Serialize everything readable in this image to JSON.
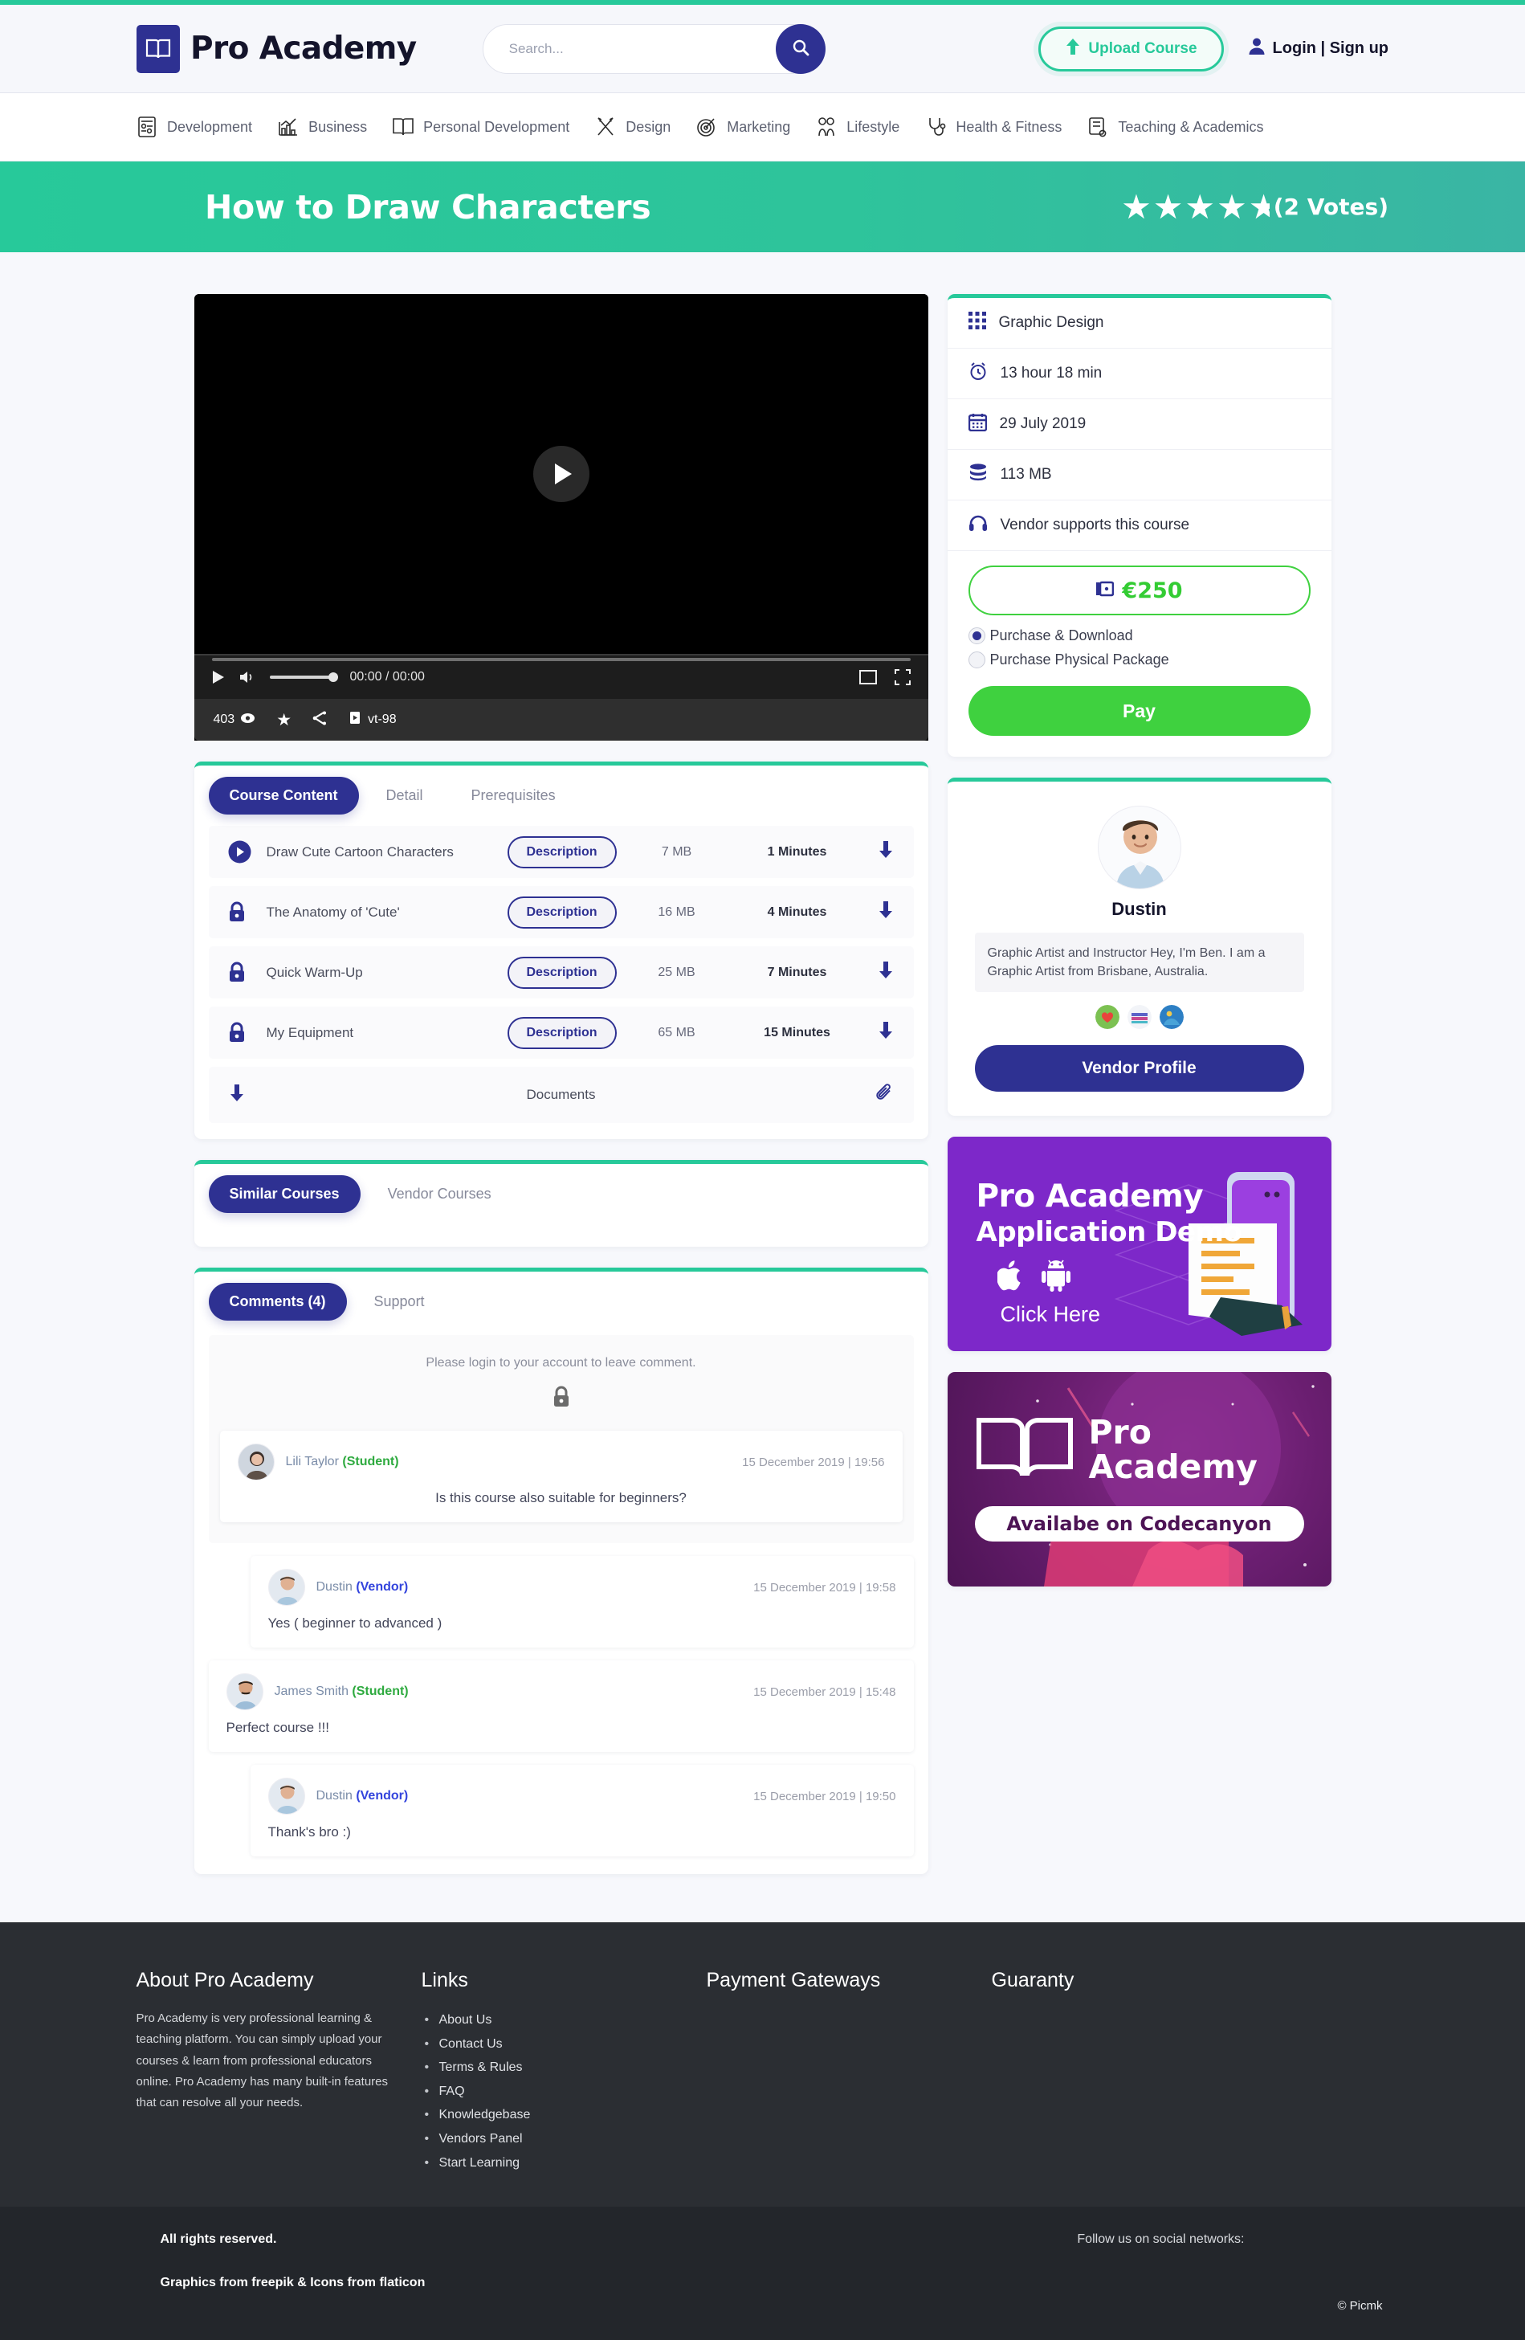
{
  "brand": {
    "name": "Pro Academy",
    "logo_icon": "open-book-icon"
  },
  "search": {
    "placeholder": "Search...",
    "value": "",
    "icon": "search-icon"
  },
  "header": {
    "upload_label": "Upload Course",
    "upload_icon": "upload-arrow-icon",
    "account_label": "Login | Sign up",
    "account_icon": "user-icon"
  },
  "categories": [
    {
      "label": "Development",
      "icon": "development-icon"
    },
    {
      "label": "Business",
      "icon": "chart-icon"
    },
    {
      "label": "Personal Development",
      "icon": "book-icon"
    },
    {
      "label": "Design",
      "icon": "pencil-ruler-icon"
    },
    {
      "label": "Marketing",
      "icon": "target-icon"
    },
    {
      "label": "Lifestyle",
      "icon": "lifestyle-icon"
    },
    {
      "label": "Health & Fitness",
      "icon": "stethoscope-icon"
    },
    {
      "label": "Teaching & Academics",
      "icon": "teaching-icon"
    }
  ],
  "hero": {
    "title": "How to Draw Characters",
    "rating_value": 4.5,
    "stars_total": 5,
    "votes_label": "(2 Votes)"
  },
  "video": {
    "time_display": "00:00 / 00:00",
    "volume_percent": 100,
    "progress_percent": 0,
    "play_icon": "play-icon",
    "volume_icon": "volume-icon",
    "pip_icon": "picture-in-picture-icon",
    "fullscreen_icon": "fullscreen-icon",
    "stats": {
      "views": "403",
      "views_icon": "eye-icon",
      "favorite_icon": "star-icon",
      "share_icon": "share-icon",
      "playlist_icon": "playlist-icon",
      "video_code": "vt-98"
    }
  },
  "content_tabs": {
    "tabs": [
      {
        "label": "Course Content",
        "active": true
      },
      {
        "label": "Detail",
        "active": false
      },
      {
        "label": "Prerequisites",
        "active": false
      }
    ],
    "rows": [
      {
        "icon": "play-circle-icon",
        "title": "Draw Cute Cartoon Characters",
        "button": "Description",
        "size": "7 MB",
        "duration": "1 Minutes",
        "download_icon": "download-icon"
      },
      {
        "icon": "lock-icon",
        "title": "The Anatomy of 'Cute'",
        "button": "Description",
        "size": "16 MB",
        "duration": "4 Minutes",
        "download_icon": "download-icon"
      },
      {
        "icon": "lock-icon",
        "title": "Quick Warm-Up",
        "button": "Description",
        "size": "25 MB",
        "duration": "7 Minutes",
        "download_icon": "download-icon"
      },
      {
        "icon": "lock-icon",
        "title": "My Equipment",
        "button": "Description",
        "size": "65 MB",
        "duration": "15 Minutes",
        "download_icon": "download-icon"
      }
    ],
    "documents_row": {
      "label": "Documents",
      "download_icon": "download-icon",
      "attach_icon": "paperclip-icon"
    }
  },
  "similar_tabs": {
    "tabs": [
      {
        "label": "Similar Courses",
        "active": true
      },
      {
        "label": "Vendor Courses",
        "active": false
      }
    ]
  },
  "comments_tabs": {
    "tabs": [
      {
        "label": "Comments (4)",
        "active": true
      },
      {
        "label": "Support",
        "active": false
      }
    ],
    "login_notice": "Please login to your account to leave comment.",
    "login_notice_icon": "lock-icon",
    "items": [
      {
        "user": "Lili Taylor",
        "role": "(Student)",
        "role_type": "student",
        "date": "15 December 2019 | 19:56",
        "text": "Is this course also suitable for beginners?",
        "indent": false,
        "avatar": "female-avatar"
      },
      {
        "user": "Dustin",
        "role": "(Vendor)",
        "role_type": "vendor",
        "date": "15 December 2019 | 19:58",
        "text": "Yes ( beginner to advanced )",
        "indent": true,
        "avatar": "male-avatar"
      },
      {
        "user": "James Smith",
        "role": "(Student)",
        "role_type": "student",
        "date": "15 December 2019 | 15:48",
        "text": "Perfect course !!!",
        "indent": false,
        "avatar": "male-avatar-2"
      },
      {
        "user": "Dustin",
        "role": "(Vendor)",
        "role_type": "vendor",
        "date": "15 December 2019 | 19:50",
        "text": "Thank's bro :)",
        "indent": true,
        "avatar": "male-avatar"
      }
    ]
  },
  "course_meta": [
    {
      "icon": "grid-icon",
      "label": "Graphic Design"
    },
    {
      "icon": "alarm-clock-icon",
      "label": "13 hour 18 min"
    },
    {
      "icon": "calendar-icon",
      "label": "29 July 2019"
    },
    {
      "icon": "database-icon",
      "label": "113 MB"
    },
    {
      "icon": "headset-icon",
      "label": "Vendor supports this course"
    }
  ],
  "purchase": {
    "price": "€250",
    "price_icon": "wallet-icon",
    "options": [
      {
        "label": "Purchase & Download",
        "selected": true
      },
      {
        "label": "Purchase Physical Package",
        "selected": false
      }
    ],
    "pay_label": "Pay"
  },
  "vendor": {
    "name": "Dustin",
    "bio": "Graphic Artist and Instructor Hey, I'm Ben. I am a Graphic Artist from Brisbane, Australia.",
    "social_icons": [
      "heart-badge-icon",
      "book-badge-icon",
      "globe-badge-icon"
    ],
    "profile_button": "Vendor Profile"
  },
  "banners": [
    {
      "id": "app-demo",
      "line1": "Pro Academy",
      "line2": "Application Demo",
      "cta": "Click Here",
      "store_icons": [
        "apple-icon",
        "android-icon"
      ]
    },
    {
      "id": "codecanyon",
      "line1": "Pro",
      "line2": "Academy",
      "cta": "Availabe on Codecanyon",
      "logo_icon": "open-book-icon"
    }
  ],
  "footer": {
    "about": {
      "heading": "About Pro Academy",
      "text": "Pro Academy is very professional learning & teaching platform. You can simply upload your courses & learn from professional educators online. Pro Academy has many built-in features that can resolve all your needs."
    },
    "links": {
      "heading": "Links",
      "items": [
        "About Us",
        "Contact Us",
        "Terms & Rules",
        "FAQ",
        "Knowledgebase",
        "Vendors Panel",
        "Start Learning"
      ]
    },
    "payment": {
      "heading": "Payment Gateways"
    },
    "guaranty": {
      "heading": "Guaranty"
    }
  },
  "subfooter": {
    "rights": "All rights reserved.",
    "graphics": "Graphics from freepik & Icons from flaticon",
    "follow": "Follow us on social networks:",
    "credit": "© Picmk"
  },
  "colors": {
    "accent_green": "#27c99a",
    "brand_navy": "#2e3192",
    "pay_green": "#3fd13f",
    "hero_gradient_start": "#27c99a",
    "hero_gradient_end": "#3ab5a4"
  }
}
